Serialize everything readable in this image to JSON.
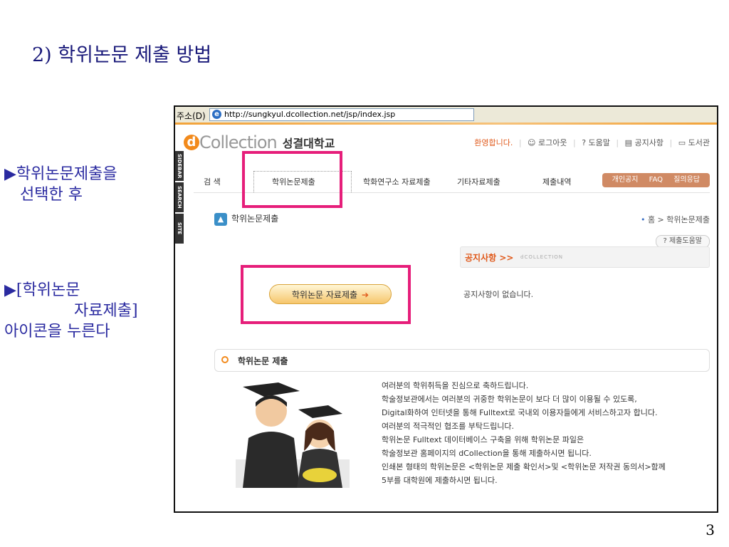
{
  "slide": {
    "title": "2) 학위논문 제출 방법",
    "note1_line1": "▶학위논문제출을",
    "note1_line2": "선택한 후",
    "note2_line1": "▶[학위논문",
    "note2_line2": "자료제출]",
    "note2_line3": "아이콘을 누른다",
    "page_number": "3"
  },
  "browser": {
    "address_label": "주소(D)",
    "url": "http://sungkyul.dcollection.net/jsp/index.jsp"
  },
  "sidebar_tabs": [
    "SIDEBAR",
    "SEARCH",
    "SITE"
  ],
  "site": {
    "logo_d": "d",
    "logo_text": "Collection",
    "logo_university": "성결대학교",
    "welcome": "환영합니다.",
    "top_links": [
      "로그아웃",
      "? 도움말",
      "공지사항",
      "도서관"
    ],
    "nav": [
      "검  색",
      "학위논문제출",
      "학화연구소 자료제출",
      "기타자료제출",
      "제출내역"
    ],
    "nav_right": [
      "개인공지",
      "FAQ",
      "질의응답"
    ],
    "section_title": "학위논문제출",
    "breadcrumb": "홈 > 학위논문제출",
    "help_button": "? 제출도움말",
    "notice_title": "공지사항 >>",
    "notice_sub": "dCOLLECTION",
    "notice_empty": "공지사항이 없습니다.",
    "submit_button": "학위논문 자료제출",
    "thesis_section_title": "학위논문 제출",
    "description": [
      "여러분의 학위취득을 진심으로 축하드립니다.",
      "학술정보관에서는 여러분의 귀중한 학위논문이 보다 더 많이 이용될 수 있도록,",
      "Digital화하여 인터넷을 통해 Fulltext로 국내외 이용자들에게 서비스하고자 합니다.",
      "여러분의 적극적인 협조를 부탁드립니다.",
      "학위논문 Fulltext 데이터베이스 구축을 위해 학위논문 파일은",
      "학술정보관 홈페이지의 dCollection을 통해 제출하시면 됩니다.",
      "인쇄본 형태의 학위논문은 <학위논문 제출 확인서>및 <학위논문 저작권 동의서>함께",
      "5부를 대학원에 제출하시면 됩니다."
    ]
  },
  "colors": {
    "highlight": "#e61e7a",
    "slide_text": "#2a2aa0",
    "accent_orange": "#f28a1c"
  }
}
